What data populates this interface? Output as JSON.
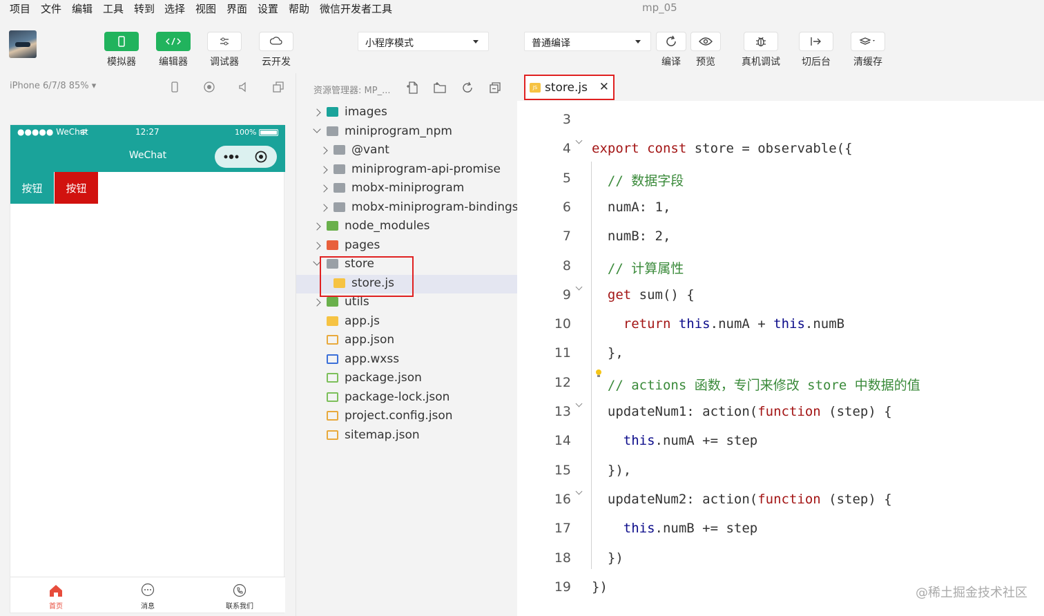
{
  "menubar": {
    "items": [
      "项目",
      "文件",
      "编辑",
      "工具",
      "转到",
      "选择",
      "视图",
      "界面",
      "设置",
      "帮助",
      "微信开发者工具"
    ],
    "window_title": "mp_05"
  },
  "toolbar": {
    "simulator": "模拟器",
    "editor": "编辑器",
    "debugger": "调试器",
    "cloud": "云开发",
    "mode": "小程序模式",
    "compile_mode": "普通编译",
    "compile": "编译",
    "preview": "预览",
    "device_debug": "真机调试",
    "background": "切后台",
    "clear_cache": "清缓存"
  },
  "simulator": {
    "device": "iPhone 6/7/8 85% ▾",
    "carrier": "●●●●● WeChat",
    "time": "12:27",
    "battery": "100%",
    "nav_title": "WeChat",
    "button1": "按钮",
    "button2": "按钮",
    "tabs": [
      "首页",
      "消息",
      "联系我们"
    ]
  },
  "explorer": {
    "title": "资源管理器: MP_...",
    "tree": [
      {
        "name": "images",
        "indent": 1,
        "chevron": "right",
        "icon": "folder-teal"
      },
      {
        "name": "miniprogram_npm",
        "indent": 1,
        "chevron": "down",
        "icon": "folder-gray"
      },
      {
        "name": "@vant",
        "indent": 2,
        "chevron": "right",
        "icon": "folder-gray"
      },
      {
        "name": "miniprogram-api-promise",
        "indent": 2,
        "chevron": "right",
        "icon": "folder-gray"
      },
      {
        "name": "mobx-miniprogram",
        "indent": 2,
        "chevron": "right",
        "icon": "folder-gray"
      },
      {
        "name": "mobx-miniprogram-bindings",
        "indent": 2,
        "chevron": "right",
        "icon": "folder-gray"
      },
      {
        "name": "node_modules",
        "indent": 1,
        "chevron": "right",
        "icon": "folder-green"
      },
      {
        "name": "pages",
        "indent": 1,
        "chevron": "right",
        "icon": "folder-red"
      },
      {
        "name": "store",
        "indent": 1,
        "chevron": "down",
        "icon": "folder-gray"
      },
      {
        "name": "store.js",
        "indent": 2,
        "chevron": "",
        "icon": "file-js",
        "selected": true
      },
      {
        "name": "utils",
        "indent": 1,
        "chevron": "right",
        "icon": "folder-green"
      },
      {
        "name": "app.js",
        "indent": 1,
        "chevron": "",
        "icon": "file-js"
      },
      {
        "name": "app.json",
        "indent": 1,
        "chevron": "",
        "icon": "file-json"
      },
      {
        "name": "app.wxss",
        "indent": 1,
        "chevron": "",
        "icon": "file-css"
      },
      {
        "name": "package.json",
        "indent": 1,
        "chevron": "",
        "icon": "file-npm"
      },
      {
        "name": "package-lock.json",
        "indent": 1,
        "chevron": "",
        "icon": "file-npm"
      },
      {
        "name": "project.config.json",
        "indent": 1,
        "chevron": "",
        "icon": "file-json"
      },
      {
        "name": "sitemap.json",
        "indent": 1,
        "chevron": "",
        "icon": "file-json"
      }
    ]
  },
  "editor": {
    "tab_name": "store.js",
    "tab_close": "✕",
    "lines": [
      {
        "n": "3",
        "code": ""
      },
      {
        "n": "4",
        "code": "export const store = observable({",
        "fold": true
      },
      {
        "n": "5",
        "code": "  // 数据字段"
      },
      {
        "n": "6",
        "code": "  numA: 1,"
      },
      {
        "n": "7",
        "code": "  numB: 2,"
      },
      {
        "n": "8",
        "code": "  // 计算属性"
      },
      {
        "n": "9",
        "code": "  get sum() {",
        "fold": true
      },
      {
        "n": "10",
        "code": "    return this.numA + this.numB"
      },
      {
        "n": "11",
        "code": "  },"
      },
      {
        "n": "12",
        "code": "  // actions 函数，专门来修改 store 中数据的值"
      },
      {
        "n": "13",
        "code": "  updateNum1: action(function (step) {",
        "fold": true
      },
      {
        "n": "14",
        "code": "    this.numA += step"
      },
      {
        "n": "15",
        "code": "  }),"
      },
      {
        "n": "16",
        "code": "  updateNum2: action(function (step) {",
        "fold": true
      },
      {
        "n": "17",
        "code": "    this.numB += step"
      },
      {
        "n": "18",
        "code": "  })"
      },
      {
        "n": "19",
        "code": "})"
      }
    ]
  },
  "watermark": "@稀土掘金技术社区"
}
